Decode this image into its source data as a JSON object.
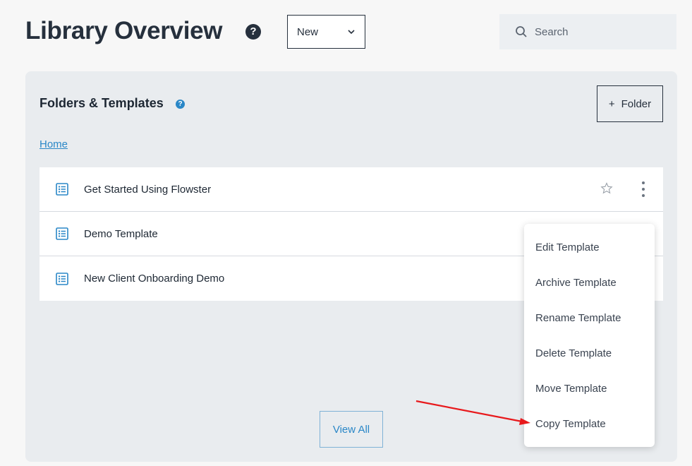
{
  "header": {
    "title": "Library Overview",
    "help_glyph": "?",
    "new_label": "New",
    "search_placeholder": "Search"
  },
  "panel": {
    "title": "Folders & Templates",
    "help_glyph": "?",
    "folder_plus": "+",
    "folder_label": "Folder",
    "breadcrumb": "Home",
    "view_all_label": "View All"
  },
  "templates": [
    {
      "name": "Get Started Using Flowster"
    },
    {
      "name": "Demo Template"
    },
    {
      "name": "New Client Onboarding Demo"
    }
  ],
  "context_menu": {
    "items": [
      "Edit Template",
      "Archive Template",
      "Rename Template",
      "Delete Template",
      "Move Template",
      "Copy Template"
    ]
  },
  "colors": {
    "accent": "#2a87c7",
    "annotation_arrow": "#e8191c"
  }
}
